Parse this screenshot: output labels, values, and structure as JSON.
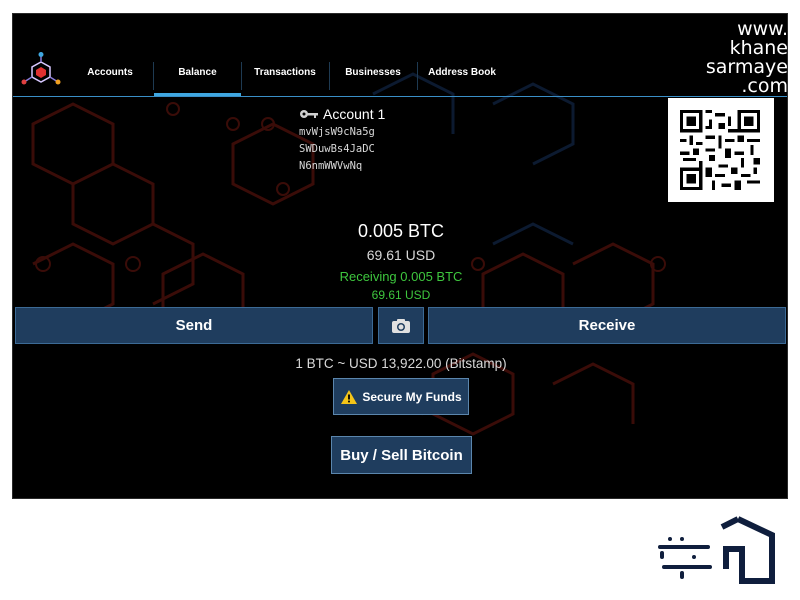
{
  "nav": {
    "tabs": [
      {
        "label": "Accounts"
      },
      {
        "label": "Balance"
      },
      {
        "label": "Transactions"
      },
      {
        "label": "Businesses"
      },
      {
        "label": "Address Book"
      }
    ]
  },
  "account": {
    "title": "Account 1",
    "address_lines": [
      "mvWjsW9cNa5g",
      "SWDuwBs4JaDC",
      "N6nmWWVwNq"
    ]
  },
  "balance": {
    "btc": "0.005 BTC",
    "usd": "69.61 USD",
    "receiving_btc": "Receiving 0.005 BTC",
    "receiving_usd": "69.61 USD"
  },
  "actions": {
    "send_label": "Send",
    "receive_label": "Receive",
    "secure_label": "Secure My Funds",
    "buy_sell_label": "Buy / Sell Bitcoin"
  },
  "exchange_rate": "1 BTC ~ USD 13,922.00 (Bitstamp)",
  "watermark": {
    "lines": [
      "www.",
      "khane",
      "sarmaye",
      ".com"
    ]
  },
  "icons": {
    "app_logo": "mycelium-logo-icon",
    "key": "key-icon",
    "camera": "camera-icon",
    "warning": "warning-icon",
    "qr": "qr-code"
  },
  "colors": {
    "accent": "#3fa7e0",
    "button_bg": "#1f3d5e",
    "receiving": "#3ec63e",
    "background": "#000000"
  }
}
